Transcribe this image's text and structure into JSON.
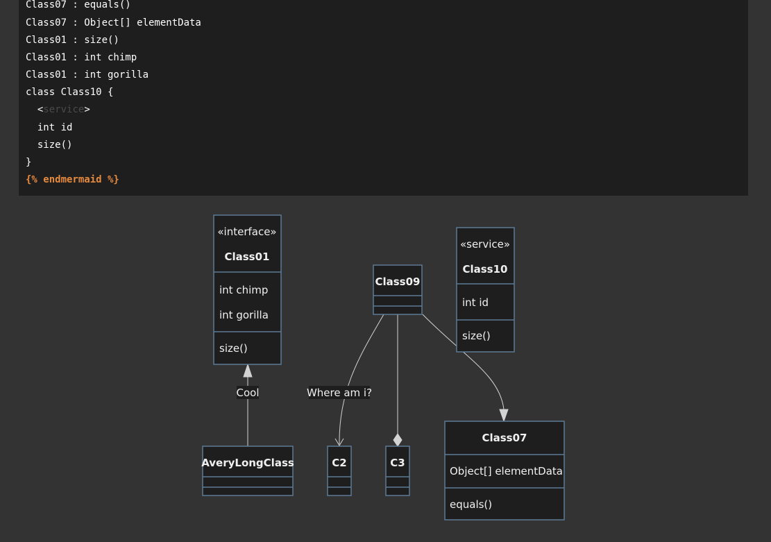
{
  "code": {
    "lines": [
      "Class07 : equals()",
      "Class07 : Object[] elementData",
      "Class01 : size()",
      "Class01 : int chimp",
      "Class01 : int gorilla",
      "class Class10 {",
      "  <",
      "  int id",
      "  size()",
      "}"
    ],
    "service_faint": "service",
    "service_close": ">",
    "liquid_end": "{% endmermaid %}"
  },
  "diagram": {
    "class01": {
      "stereotype": "«interface»",
      "name": "Class01",
      "attributes": [
        "int chimp",
        "int gorilla"
      ],
      "methods": [
        "size()"
      ]
    },
    "class09": {
      "name": "Class09"
    },
    "class10": {
      "stereotype": "«service»",
      "name": "Class10",
      "attributes": [
        "int id"
      ],
      "methods": [
        "size()"
      ]
    },
    "averylongclass": {
      "name": "AveryLongClass"
    },
    "c2": {
      "name": "C2"
    },
    "c3": {
      "name": "C3"
    },
    "class07": {
      "name": "Class07",
      "attributes": [
        "Object[] elementData"
      ],
      "methods": [
        "equals()"
      ]
    },
    "edge_labels": {
      "cool": "Cool",
      "where": "Where am i?"
    }
  }
}
